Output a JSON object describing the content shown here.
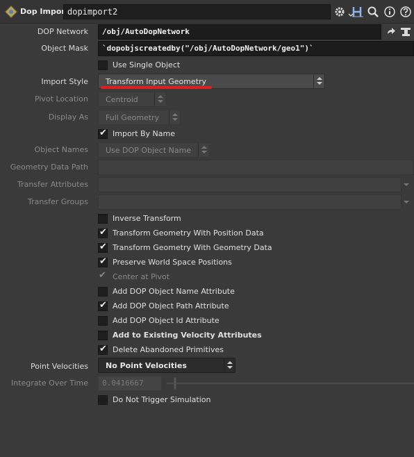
{
  "header": {
    "node_type": "Dop Import",
    "node_name": "dopimport2",
    "icons": [
      "dop-import-node-icon",
      "gear-icon",
      "houdini-help-h-icon",
      "search-icon",
      "info-icon",
      "help-icon"
    ]
  },
  "params": {
    "dop_network": {
      "label": "DOP Network",
      "value": "/obj/AutoDopNetwork"
    },
    "object_mask": {
      "label": "Object Mask",
      "value": "`dopobjscreatedby(\"/obj/AutoDopNetwork/geo1\")`"
    },
    "use_single_object": {
      "label": "Use Single Object",
      "checked": false
    },
    "import_style": {
      "label": "Import Style",
      "value": "Transform Input Geometry"
    },
    "pivot_location": {
      "label": "Pivot Location",
      "value": "Centroid"
    },
    "display_as": {
      "label": "Display As",
      "value": "Full Geometry"
    },
    "import_by_name": {
      "label": "Import By Name",
      "checked": true
    },
    "object_names": {
      "label": "Object Names",
      "value": "Use DOP Object Name"
    },
    "geometry_data_path": {
      "label": "Geometry Data Path",
      "value": ""
    },
    "transfer_attributes": {
      "label": "Transfer Attributes",
      "value": ""
    },
    "transfer_groups": {
      "label": "Transfer Groups",
      "value": ""
    },
    "inverse_transform": {
      "label": "Inverse Transform",
      "checked": false
    },
    "xform_pos_data": {
      "label": "Transform Geometry With Position Data",
      "checked": true
    },
    "xform_geo_data": {
      "label": "Transform Geometry With Geometry Data",
      "checked": true
    },
    "preserve_world": {
      "label": "Preserve World Space Positions",
      "checked": true
    },
    "center_at_pivot": {
      "label": "Center at Pivot",
      "checked": true
    },
    "add_name_attr": {
      "label": "Add DOP Object Name Attribute",
      "checked": false
    },
    "add_path_attr": {
      "label": "Add DOP Object Path Attribute",
      "checked": true
    },
    "add_id_attr": {
      "label": "Add DOP Object Id Attribute",
      "checked": false
    },
    "add_existing_vel": {
      "label": "Add to Existing Velocity Attributes",
      "checked": false
    },
    "delete_abandoned": {
      "label": "Delete Abandoned Primitives",
      "checked": true
    },
    "point_velocities": {
      "label": "Point Velocities",
      "value": "No Point Velocities"
    },
    "integrate_over_time": {
      "label": "Integrate Over Time",
      "value": "0.0416667"
    },
    "do_not_trigger": {
      "label": "Do Not Trigger Simulation",
      "checked": false
    }
  },
  "colors": {
    "annotation_underline": "#e21d1d",
    "background": "#3a3a3a"
  }
}
